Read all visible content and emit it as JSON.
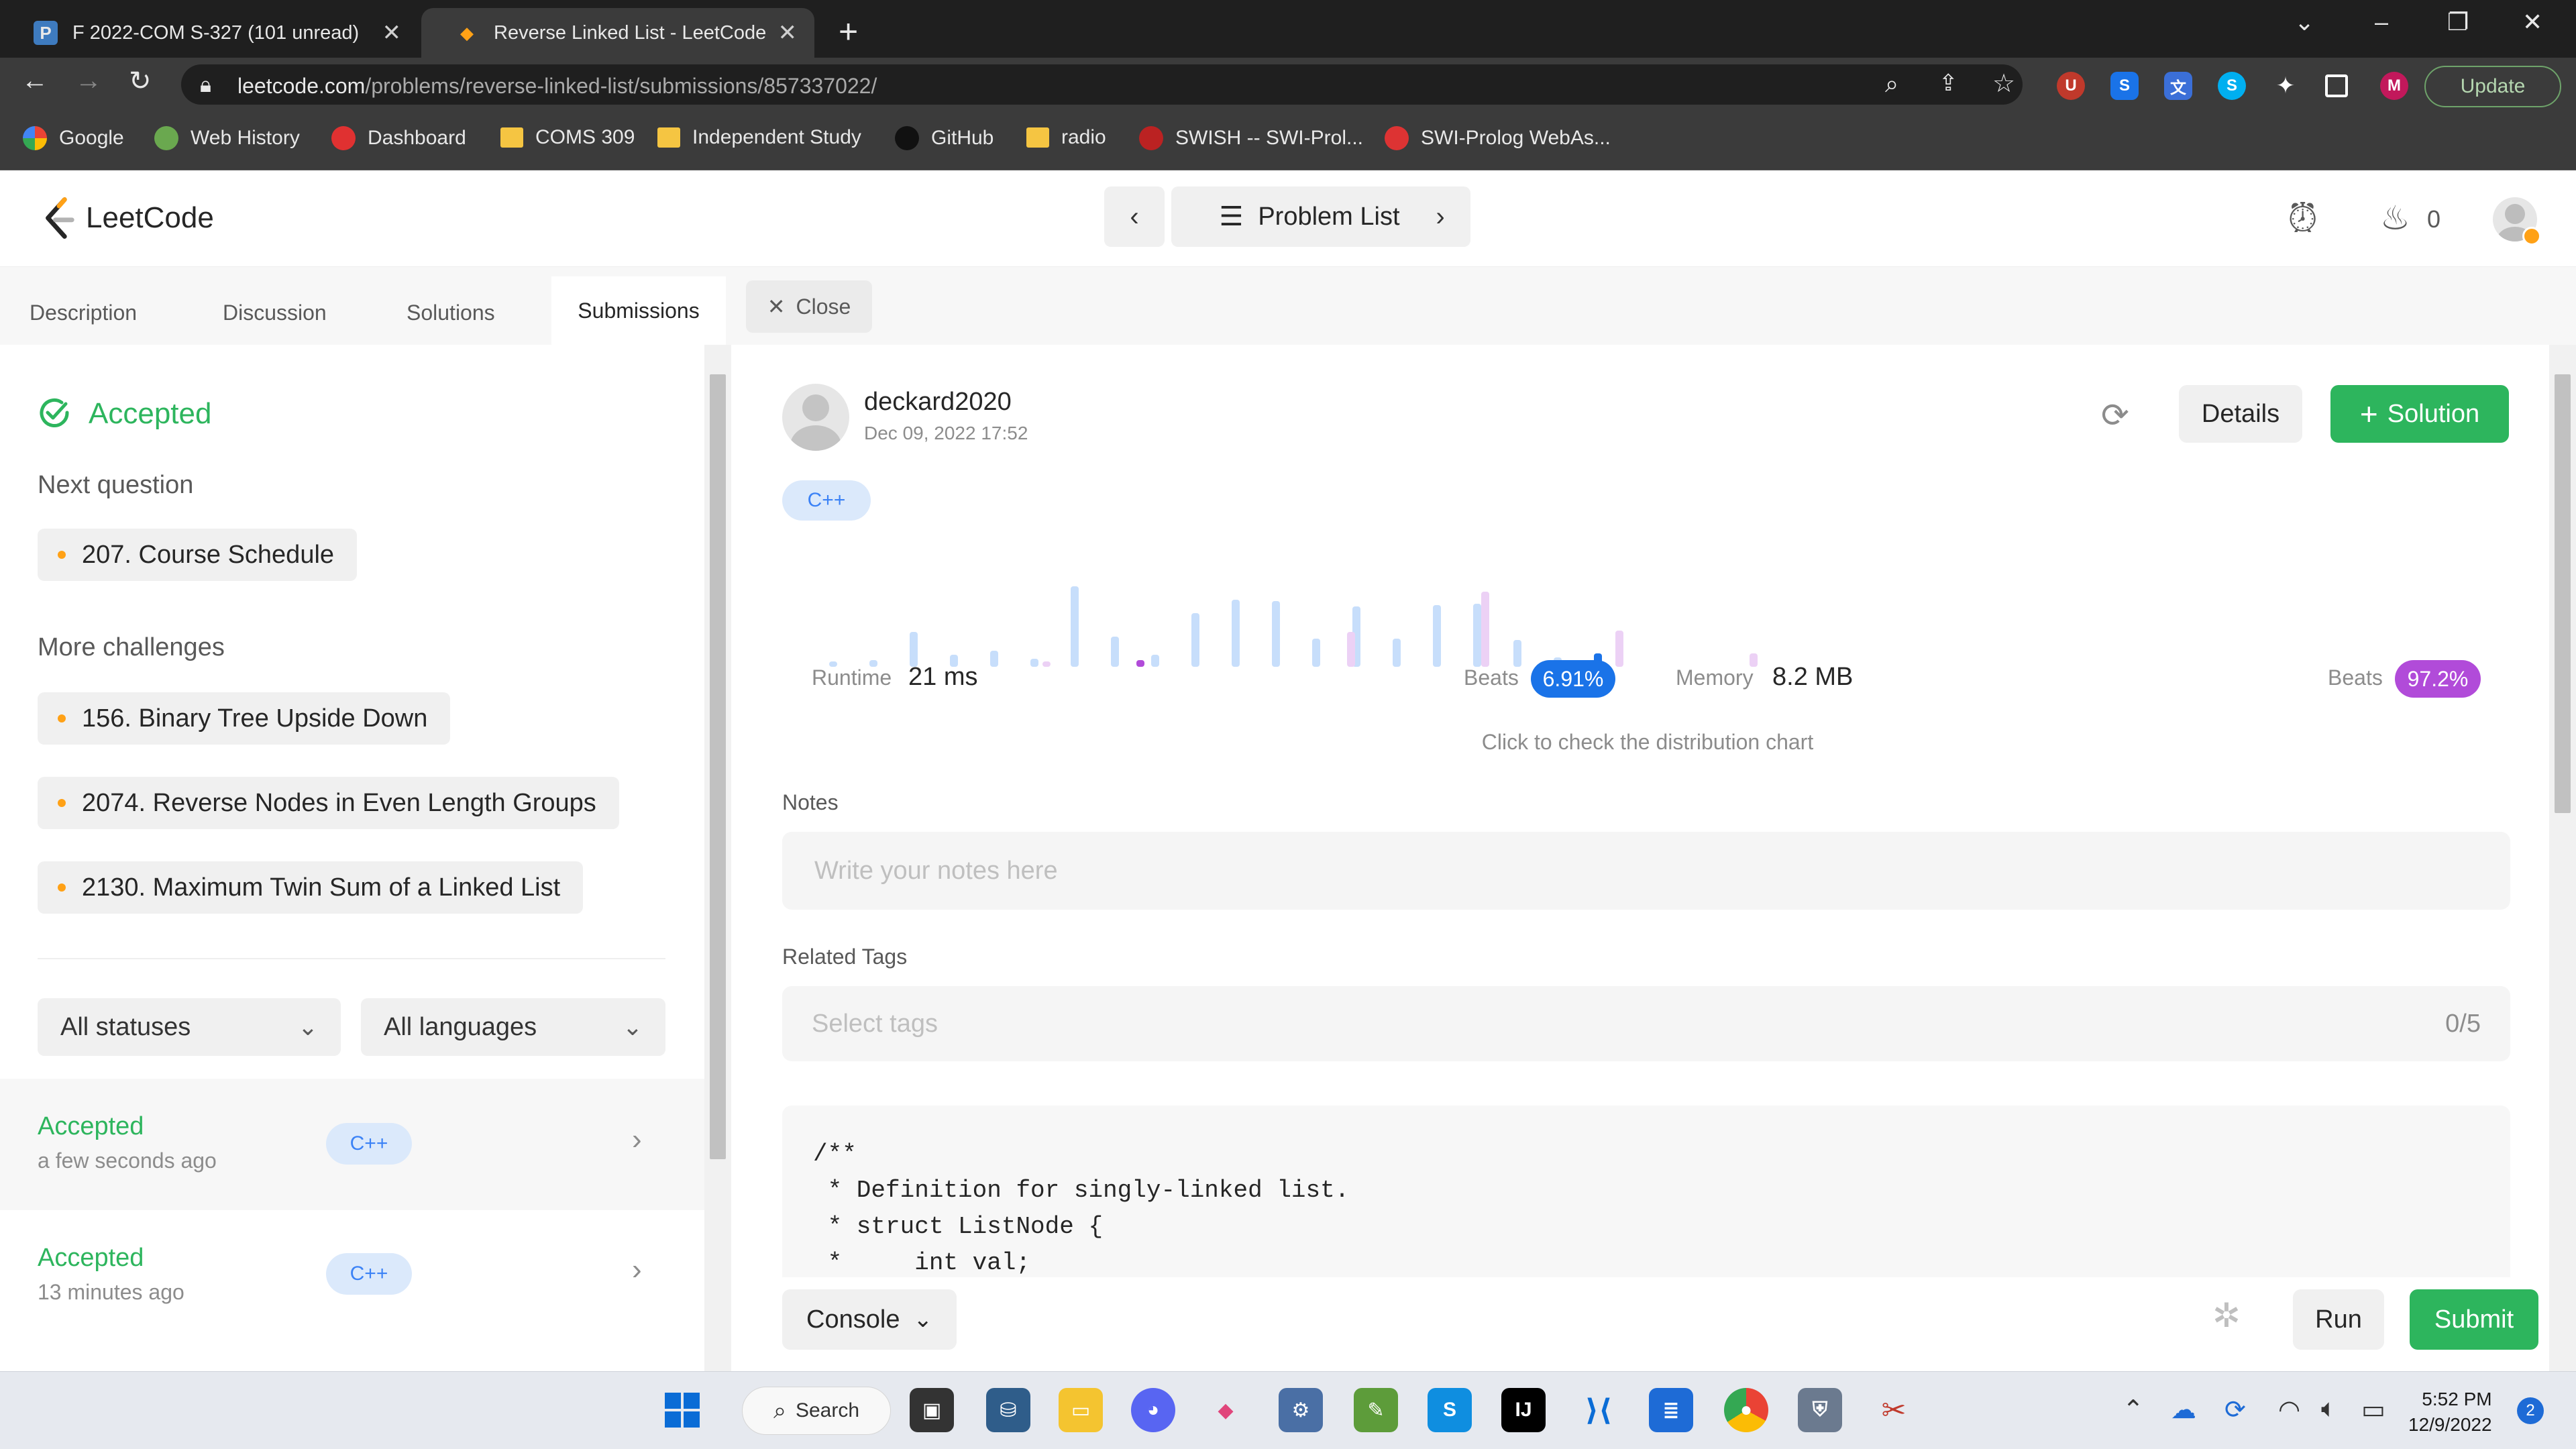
{
  "browser": {
    "tabs": [
      {
        "title": "F 2022-COM S-327 (101 unread)",
        "icon": "piazza-icon",
        "active": false
      },
      {
        "title": "Reverse Linked List - LeetCode",
        "icon": "leetcode-icon",
        "active": true
      }
    ],
    "url_host": "leetcode.com",
    "url_path": "/problems/reverse-linked-list/submissions/857337022/",
    "update_label": "Update",
    "profile_initial": "M",
    "bookmarks": [
      {
        "label": "Google"
      },
      {
        "label": "Web History"
      },
      {
        "label": "Dashboard"
      },
      {
        "label": "COMS 309"
      },
      {
        "label": "Independent Study"
      },
      {
        "label": "GitHub"
      },
      {
        "label": "radio"
      },
      {
        "label": "SWISH -- SWI-Prol..."
      },
      {
        "label": "SWI-Prolog WebAs..."
      }
    ]
  },
  "header": {
    "logo": "LeetCode",
    "problem_list": "Problem List",
    "streak_count": "0"
  },
  "tabs": {
    "description": "Description",
    "discussion": "Discussion",
    "solutions": "Solutions",
    "submissions": "Submissions",
    "close": "Close"
  },
  "left": {
    "status": "Accepted",
    "next_question_label": "Next question",
    "next_question": "207. Course Schedule",
    "more_challenges_label": "More challenges",
    "challenges": [
      "156. Binary Tree Upside Down",
      "2074. Reverse Nodes in Even Length Groups",
      "2130. Maximum Twin Sum of a Linked List"
    ],
    "filter_status": "All statuses",
    "filter_language": "All languages",
    "submissions": [
      {
        "status": "Accepted",
        "time": "a few seconds ago",
        "lang": "C++"
      },
      {
        "status": "Accepted",
        "time": "13 minutes ago",
        "lang": "C++"
      }
    ]
  },
  "submission": {
    "user": "deckard2020",
    "date": "Dec 09, 2022 17:52",
    "lang": "C++",
    "details": "Details",
    "solution": "Solution",
    "runtime_label": "Runtime",
    "runtime_value": "21 ms",
    "runtime_beats_label": "Beats",
    "runtime_beats": "6.91%",
    "memory_label": "Memory",
    "memory_value": "8.2 MB",
    "memory_beats_label": "Beats",
    "memory_beats": "97.2%",
    "chart_hint": "Click to check the distribution chart",
    "notes_label": "Notes",
    "notes_placeholder": "Write your notes here",
    "tags_label": "Related Tags",
    "tags_placeholder": "Select tags",
    "tags_count": "0/5",
    "code": [
      "/**",
      " * Definition for singly-linked list.",
      " * struct ListNode {",
      " *     int val;"
    ]
  },
  "footer": {
    "console": "Console",
    "run": "Run",
    "submit": "Submit"
  },
  "taskbar": {
    "search": "Search",
    "time": "5:52 PM",
    "date": "12/9/2022",
    "notification_count": "2"
  },
  "colors": {
    "accent_green": "#2db55d",
    "beats_blue": "#1a73e8",
    "beats_purple": "#b14bd9",
    "lc_orange": "#ffa116"
  }
}
